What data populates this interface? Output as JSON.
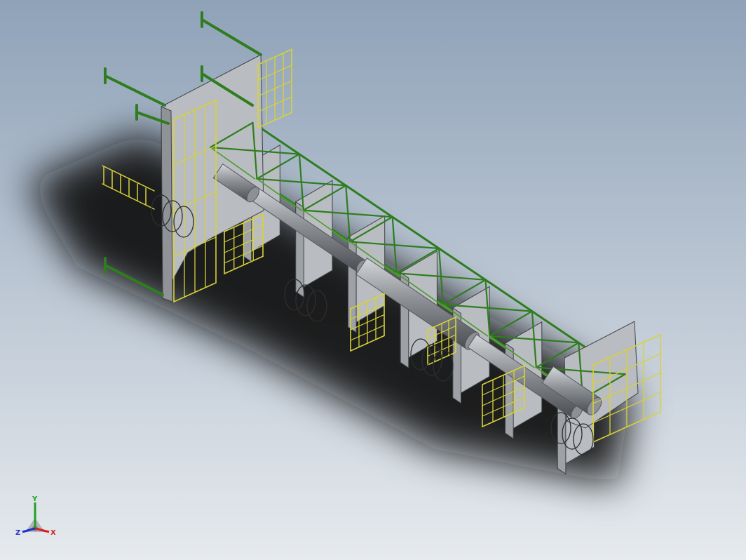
{
  "colors": {
    "background_top": "#8fa2b8",
    "background_bottom": "#e6eaee",
    "shadow": "#1b1c1e",
    "plate_fill": "#b9bcc0",
    "plate_edge": "#3e4246",
    "truss": "#2e7d1e",
    "truss_light": "#4d9a2e",
    "railing": "#d8d235",
    "cylinder": "#8d9195",
    "cylinder_dark": "#55595d",
    "axis_x": "#d42020",
    "axis_y": "#22a022",
    "axis_z": "#2030c8"
  },
  "view": {
    "projection": "isometric",
    "model": "truss-frame-assembly"
  },
  "triad": {
    "x_label": "X",
    "y_label": "Y",
    "z_label": "Z"
  }
}
